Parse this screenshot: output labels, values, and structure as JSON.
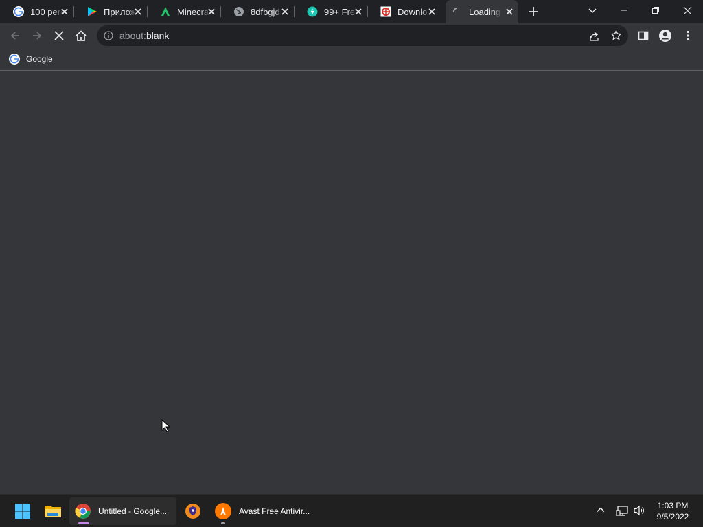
{
  "tabs": [
    {
      "title": "100 perc",
      "icon": "google-icon"
    },
    {
      "title": "Прилож",
      "icon": "google-play-icon"
    },
    {
      "title": "Minecra",
      "icon": "aptoide-icon"
    },
    {
      "title": "8dfbgjd",
      "icon": "globe-icon"
    },
    {
      "title": "99+ Free",
      "icon": "free-icon"
    },
    {
      "title": "Downlo",
      "icon": "download-site-icon"
    },
    {
      "title": "Loading",
      "icon": "loading-spinner-icon"
    }
  ],
  "address_bar": {
    "prefix": "about:",
    "host": "blank"
  },
  "bookmarks": [
    {
      "label": "Google"
    }
  ],
  "taskbar": {
    "items": [
      {
        "label": "Untitled - Google...",
        "app": "chrome-icon"
      },
      {
        "label": "Avast Free Antivir...",
        "app": "avast-icon"
      }
    ],
    "clock": {
      "time": "1:03 PM",
      "date": "9/5/2022"
    }
  },
  "colors": {
    "tabstrip": "#202124",
    "toolbar": "#35363a",
    "taskbar": "#202020",
    "accent": "#4cc2ff"
  }
}
